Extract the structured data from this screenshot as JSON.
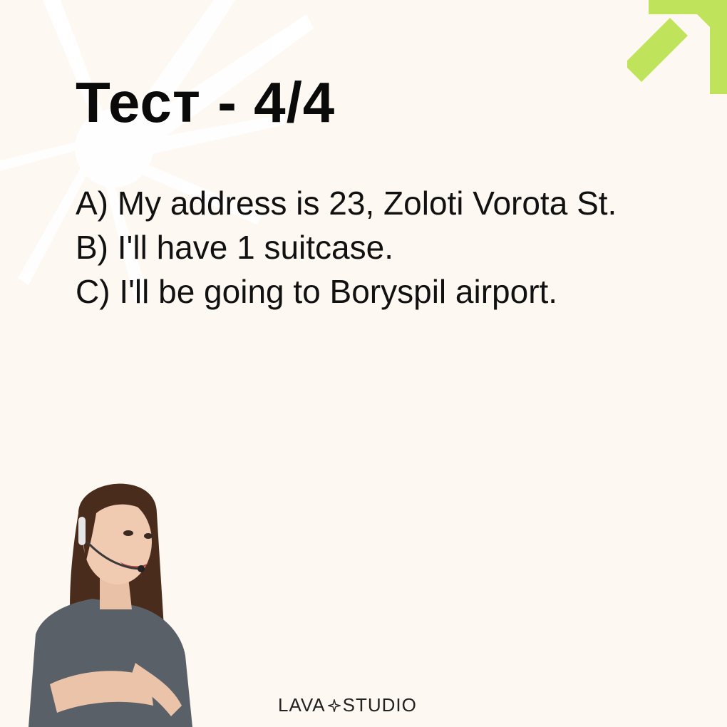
{
  "slide": {
    "title": "Тест - 4/4",
    "options": [
      {
        "letter": "A)",
        "text": "My address is 23, Zoloti Vorota St."
      },
      {
        "letter": "B)",
        "text": "I'll have 1 suitcase."
      },
      {
        "letter": "C)",
        "text": "I'll be going to Boryspil airport."
      }
    ]
  },
  "brand": {
    "left": "LAVA",
    "right": "STUDIO"
  },
  "colors": {
    "background": "#fdf8f1",
    "accent": "#bfe35a",
    "text": "#0a0a0a"
  },
  "icons": {
    "decor_arrow": "arrow-up-right-icon",
    "decor_burst": "starburst-shape",
    "logo_mark": "diamond-star-icon"
  }
}
